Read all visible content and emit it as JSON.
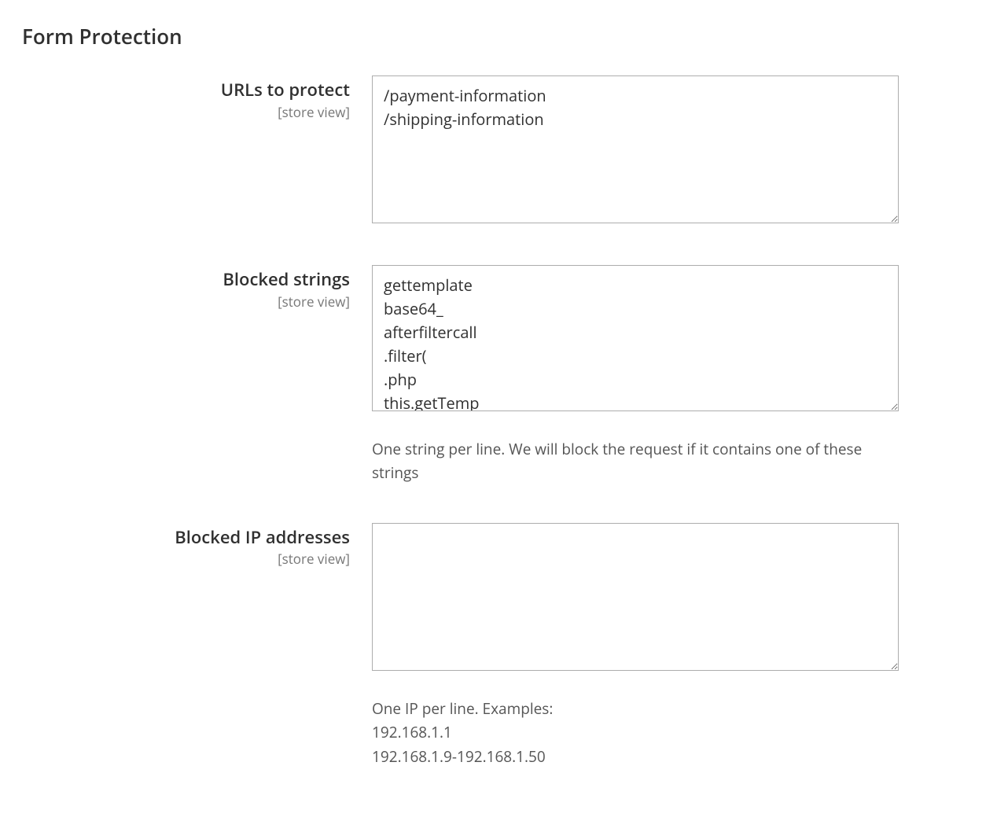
{
  "section": {
    "title": "Form Protection"
  },
  "fields": {
    "urls_to_protect": {
      "label": "URLs to protect",
      "scope": "[store view]",
      "value": "/payment-information\n/shipping-information"
    },
    "blocked_strings": {
      "label": "Blocked strings",
      "scope": "[store view]",
      "value": "gettemplate\nbase64_\nafterfiltercall\n.filter(\n.php\nthis.getTemp",
      "hint": "One string per line. We will block the request if it contains one of these strings"
    },
    "blocked_ips": {
      "label": "Blocked IP addresses",
      "scope": "[store view]",
      "value": "",
      "hint": "One IP per line. Examples:\n192.168.1.1\n192.168.1.9-192.168.1.50"
    }
  }
}
